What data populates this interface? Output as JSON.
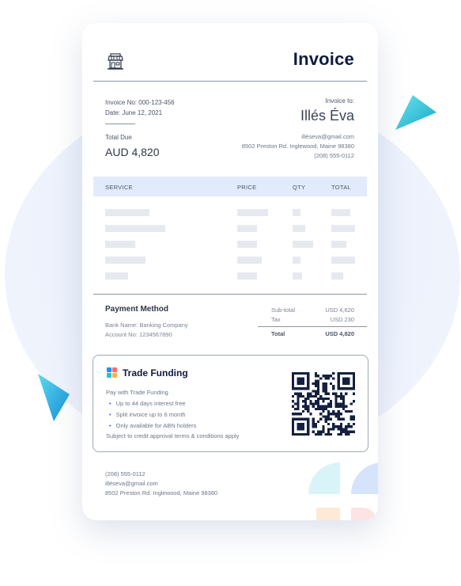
{
  "invoice": {
    "title": "Invoice",
    "number": "Invoice No: 000-123-456",
    "date": "Date: June 12, 2021",
    "total_due_label": "Total Due",
    "total_due_amount": "AUD 4,820"
  },
  "recipient": {
    "label": "Invoice to:",
    "name": "Illés Éva",
    "email": "illéseva@gmail.com",
    "address": "8502 Preston Rd. Inglewood, Maine 98380",
    "phone": "(208) 555-0112"
  },
  "table": {
    "headers": [
      "SERVICE",
      "PRICE",
      "QTY",
      "TOTAL"
    ]
  },
  "payment": {
    "title": "Payment Method",
    "bank": "Bank Name: Banking Company",
    "account": "Account No: 1234567890"
  },
  "totals": {
    "subtotal_label": "Sub-total",
    "subtotal_value": "USD 4,620",
    "tax_label": "Tax",
    "tax_value": "USD 230",
    "total_label": "Total",
    "total_value": "USD 4,820"
  },
  "trade_funding": {
    "title": "Trade Funding",
    "subtitle": "Pay with Trade Funding",
    "bullets": [
      "Up to 44 days interest free",
      "Split invoice up to 6 month",
      "Only available for ABN holders"
    ],
    "terms": "Subject to credit approval terms & conditions apply"
  },
  "footer": {
    "phone": "(208) 555-0112",
    "email": "illéseva@gmail.com",
    "address": "8502 Preston Rd. Inglewood, Maine 98380"
  },
  "colors": {
    "navy": "#0f1b3d",
    "table_header_bg": "#e2ebfb",
    "accent_cyan": "#22c3dc",
    "bullet_blue": "#3c5bd6"
  },
  "icons": [
    "storefront-icon",
    "trade-funding-logo-icon",
    "qr-code-icon"
  ]
}
